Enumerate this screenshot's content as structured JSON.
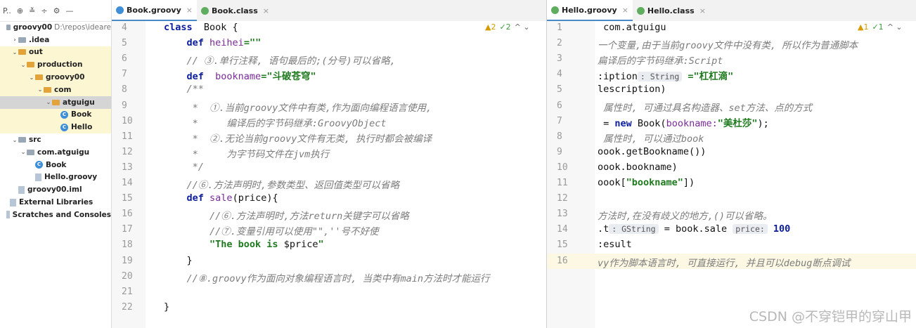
{
  "project": {
    "toolbar": [
      "P..",
      "⊕",
      "≚",
      "÷",
      "⚙",
      "—"
    ],
    "tree": [
      {
        "label": "groovy00",
        "extra": "D:\\repos\\ideare",
        "indent": 0,
        "arrow": "",
        "icon": "folder",
        "sel": false,
        "hl": false
      },
      {
        "label": ".idea",
        "extra": "",
        "indent": 1,
        "arrow": "›",
        "icon": "folder",
        "sel": false,
        "hl": false
      },
      {
        "label": "out",
        "extra": "",
        "indent": 1,
        "arrow": "⌄",
        "icon": "folder-orange",
        "sel": false,
        "hl": true
      },
      {
        "label": "production",
        "extra": "",
        "indent": 2,
        "arrow": "⌄",
        "icon": "folder-orange",
        "sel": false,
        "hl": true
      },
      {
        "label": "groovy00",
        "extra": "",
        "indent": 3,
        "arrow": "⌄",
        "icon": "folder-orange",
        "sel": false,
        "hl": true
      },
      {
        "label": "com",
        "extra": "",
        "indent": 4,
        "arrow": "⌄",
        "icon": "folder-orange",
        "sel": false,
        "hl": true
      },
      {
        "label": "atguigu",
        "extra": "",
        "indent": 5,
        "arrow": "⌄",
        "icon": "folder-orange",
        "sel": true,
        "hl": false
      },
      {
        "label": "Book",
        "extra": "",
        "indent": 6,
        "arrow": "",
        "icon": "class",
        "sel": false,
        "hl": true
      },
      {
        "label": "Hello",
        "extra": "",
        "indent": 6,
        "arrow": "",
        "icon": "class",
        "sel": false,
        "hl": true
      },
      {
        "label": "src",
        "extra": "",
        "indent": 1,
        "arrow": "⌄",
        "icon": "folder",
        "sel": false,
        "hl": false
      },
      {
        "label": "com.atguigu",
        "extra": "",
        "indent": 2,
        "arrow": "⌄",
        "icon": "folder",
        "sel": false,
        "hl": false
      },
      {
        "label": "Book",
        "extra": "",
        "indent": 3,
        "arrow": "",
        "icon": "class",
        "sel": false,
        "hl": false
      },
      {
        "label": "Hello.groovy",
        "extra": "",
        "indent": 3,
        "arrow": "",
        "icon": "file",
        "sel": false,
        "hl": false
      },
      {
        "label": "groovy00.iml",
        "extra": "",
        "indent": 1,
        "arrow": "",
        "icon": "file",
        "sel": false,
        "hl": false
      },
      {
        "label": "External Libraries",
        "extra": "",
        "indent": 0,
        "arrow": "",
        "icon": "file",
        "sel": false,
        "hl": false
      },
      {
        "label": "Scratches and Consoles",
        "extra": "",
        "indent": 0,
        "arrow": "",
        "icon": "file",
        "sel": false,
        "hl": false
      }
    ]
  },
  "left_editor": {
    "tabs": [
      {
        "label": "Book.groovy",
        "active": true,
        "icon": "class"
      },
      {
        "label": "Book.class",
        "active": false,
        "icon": "groovy"
      }
    ],
    "inspection": {
      "warnings": "▲2",
      "ok": "✓2",
      "nav": "^ ⌄"
    },
    "line_numbers": [
      "4",
      "5",
      "6",
      "7",
      "8",
      "9",
      "10",
      "11",
      "12",
      "13",
      "14",
      "15",
      "16",
      "17",
      "18",
      "19",
      "20",
      "21",
      "22"
    ],
    "lines": [
      [
        [
          "kw",
          "class"
        ],
        [
          "",
          "  Book {"
        ]
      ],
      [
        [
          "kw",
          "    def"
        ],
        [
          "fld",
          " heihei"
        ],
        [
          "",
          ""
        ],
        [
          "str",
          "=\"\""
        ]
      ],
      [
        [
          "cmt",
          "    // ③.单行注释, 语句最后的;(分号)可以省略,"
        ]
      ],
      [
        [
          "kw",
          "    def"
        ],
        [
          "fld",
          "  bookname"
        ],
        [
          "str",
          "=\"斗破苍穹\""
        ]
      ],
      [
        [
          "cmt",
          "    /**"
        ]
      ],
      [
        [
          "cmt",
          "     *  ①.当前groovy文件中有类,作为面向编程语言使用,"
        ]
      ],
      [
        [
          "cmt",
          "     *     编译后的字节码继承:GroovyObject"
        ]
      ],
      [
        [
          "cmt",
          "     *  ②.无论当前groovy文件有无类, 执行时都会被编译"
        ]
      ],
      [
        [
          "cmt",
          "     *     为字节码文件在jvm执行"
        ]
      ],
      [
        [
          "cmt",
          "     */"
        ]
      ],
      [
        [
          "cmt",
          "    //⑥.方法声明时,参数类型、返回值类型可以省略"
        ]
      ],
      [
        [
          "kw",
          "    def"
        ],
        [
          "",
          " "
        ],
        [
          "fld",
          "sale"
        ],
        [
          "",
          "(price){"
        ]
      ],
      [
        [
          "cmt",
          "        //⑥.方法声明时,方法return关键字可以省略"
        ]
      ],
      [
        [
          "cmt",
          "        //⑦.变量引用可以使用\"\",''号不好使"
        ]
      ],
      [
        [
          "str",
          "        \"The book is "
        ],
        [
          "",
          "$price"
        ],
        [
          "str",
          "\""
        ]
      ],
      [
        [
          "",
          "    }"
        ]
      ],
      [
        [
          "cmt",
          "    //⑧.groovy作为面向对象编程语言时, 当类中有main方法时才能运行"
        ]
      ],
      [
        [
          "",
          ""
        ]
      ],
      [
        [
          "",
          "}"
        ]
      ]
    ]
  },
  "right_editor": {
    "tabs": [
      {
        "label": "Hello.groovy",
        "active": true,
        "icon": "groovy"
      },
      {
        "label": "Hello.class",
        "active": false,
        "icon": "groovy"
      }
    ],
    "inspection": {
      "warnings": "▲1",
      "ok": "✓1",
      "nav": "^ ⌄"
    },
    "line_numbers": [
      "1",
      "2",
      "3",
      "4",
      "5",
      "6",
      "7",
      "8",
      "9",
      "10",
      "11",
      "12",
      "13",
      "14",
      "15",
      "16"
    ],
    "lines": [
      [
        [
          "",
          " com.atguigu"
        ]
      ],
      [
        [
          "cmt",
          "一个变量,由于当前groovy文件中没有类, 所以作为普通脚本"
        ]
      ],
      [
        [
          "cmt",
          "扁译后的字节码继承:Script"
        ]
      ],
      [
        [
          "",
          ":iption"
        ],
        [
          "hint",
          ": String"
        ],
        [
          "str",
          " =\"杠杠滴\""
        ]
      ],
      [
        [
          "",
          "lescription)"
        ]
      ],
      [
        [
          "cmt",
          " 属性时, 可通过具名构造器、set方法、点的方式"
        ]
      ],
      [
        [
          "",
          " = "
        ],
        [
          "kw",
          "new"
        ],
        [
          "",
          " Book("
        ],
        [
          "fld",
          "bookname:"
        ],
        [
          "str",
          "\"美杜莎\""
        ],
        [
          "",
          ");"
        ]
      ],
      [
        [
          "cmt",
          " 属性时, 可以通过book"
        ]
      ],
      [
        [
          "",
          "oook.getBookname())"
        ]
      ],
      [
        [
          "",
          "oook.bookname)"
        ]
      ],
      [
        [
          "",
          "oook["
        ],
        [
          "str",
          "\"bookname\""
        ],
        [
          "",
          "])"
        ]
      ],
      [
        [
          "",
          ""
        ]
      ],
      [
        [
          "cmt",
          "方法时,在没有歧义的地方,()可以省略。"
        ]
      ],
      [
        [
          "",
          ".t"
        ],
        [
          "hint",
          ": GString"
        ],
        [
          "",
          " = book.sale "
        ],
        [
          "hint",
          "price:"
        ],
        [
          "kw",
          " 100"
        ]
      ],
      [
        [
          "",
          ":esult"
        ]
      ],
      [
        [
          "cmt",
          "vy作为脚本语言时, 可直接运行, 并且可以debug断点调试"
        ]
      ]
    ]
  },
  "watermark": "CSDN @不穿铠甲的穿山甲"
}
